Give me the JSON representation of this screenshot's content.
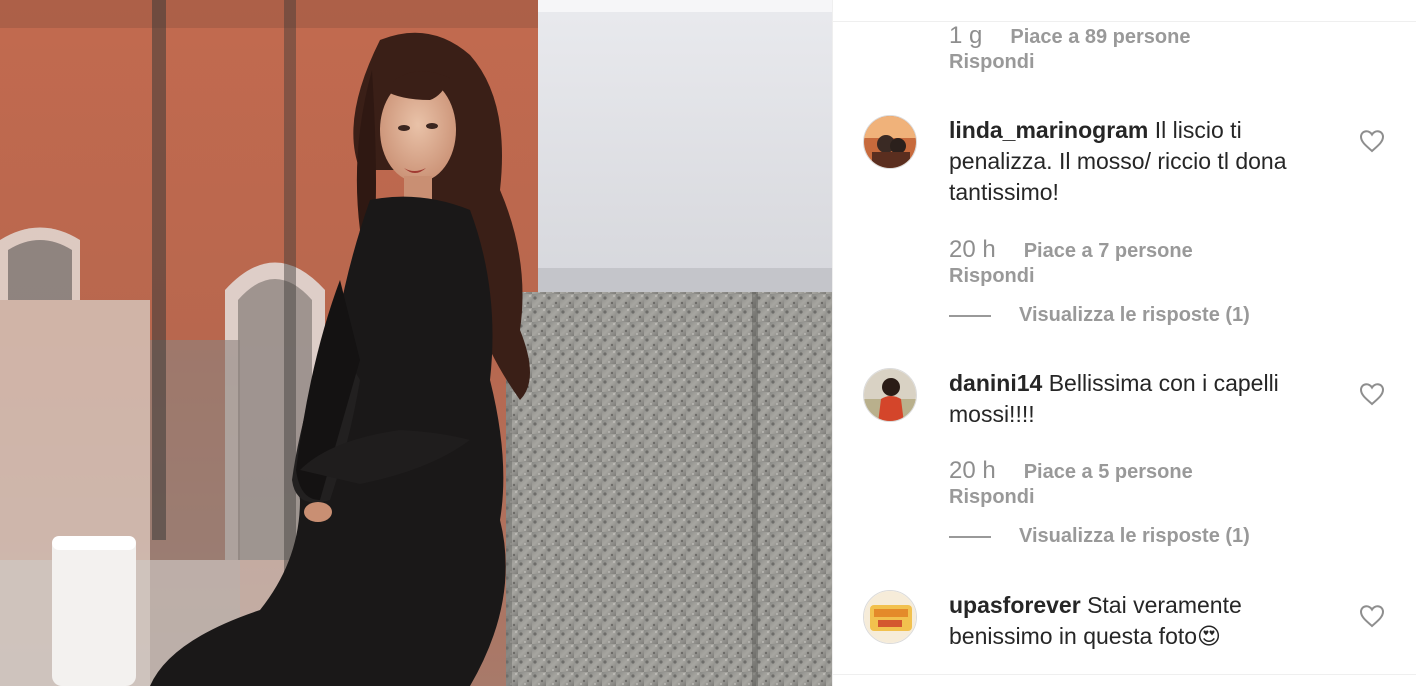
{
  "first_comment_tail": {
    "time": "1 g",
    "likes": "Piace a 89 persone",
    "reply_label": "Rispondi"
  },
  "comments": [
    {
      "username": "linda_marinogram",
      "text": "Il liscio ti penalizza. Il mosso/ riccio tl dona tantissimo!",
      "time": "20 h",
      "likes": "Piace a 7 persone",
      "reply_label": "Rispondi",
      "view_replies": "Visualizza le risposte (1)",
      "like_icon": "heart-outline-icon"
    },
    {
      "username": "danini14",
      "text": "Bellissima con i capelli mossi!!!!",
      "time": "20 h",
      "likes": "Piace a 5 persone",
      "reply_label": "Rispondi",
      "view_replies": "Visualizza le risposte (1)",
      "like_icon": "heart-outline-icon"
    },
    {
      "username": "upasforever",
      "text": "Stai veramente benissimo in questa foto😍",
      "like_icon": "heart-outline-icon"
    }
  ],
  "colors": {
    "text_primary": "#262626",
    "text_secondary": "#999999",
    "divider": "#efefef"
  }
}
